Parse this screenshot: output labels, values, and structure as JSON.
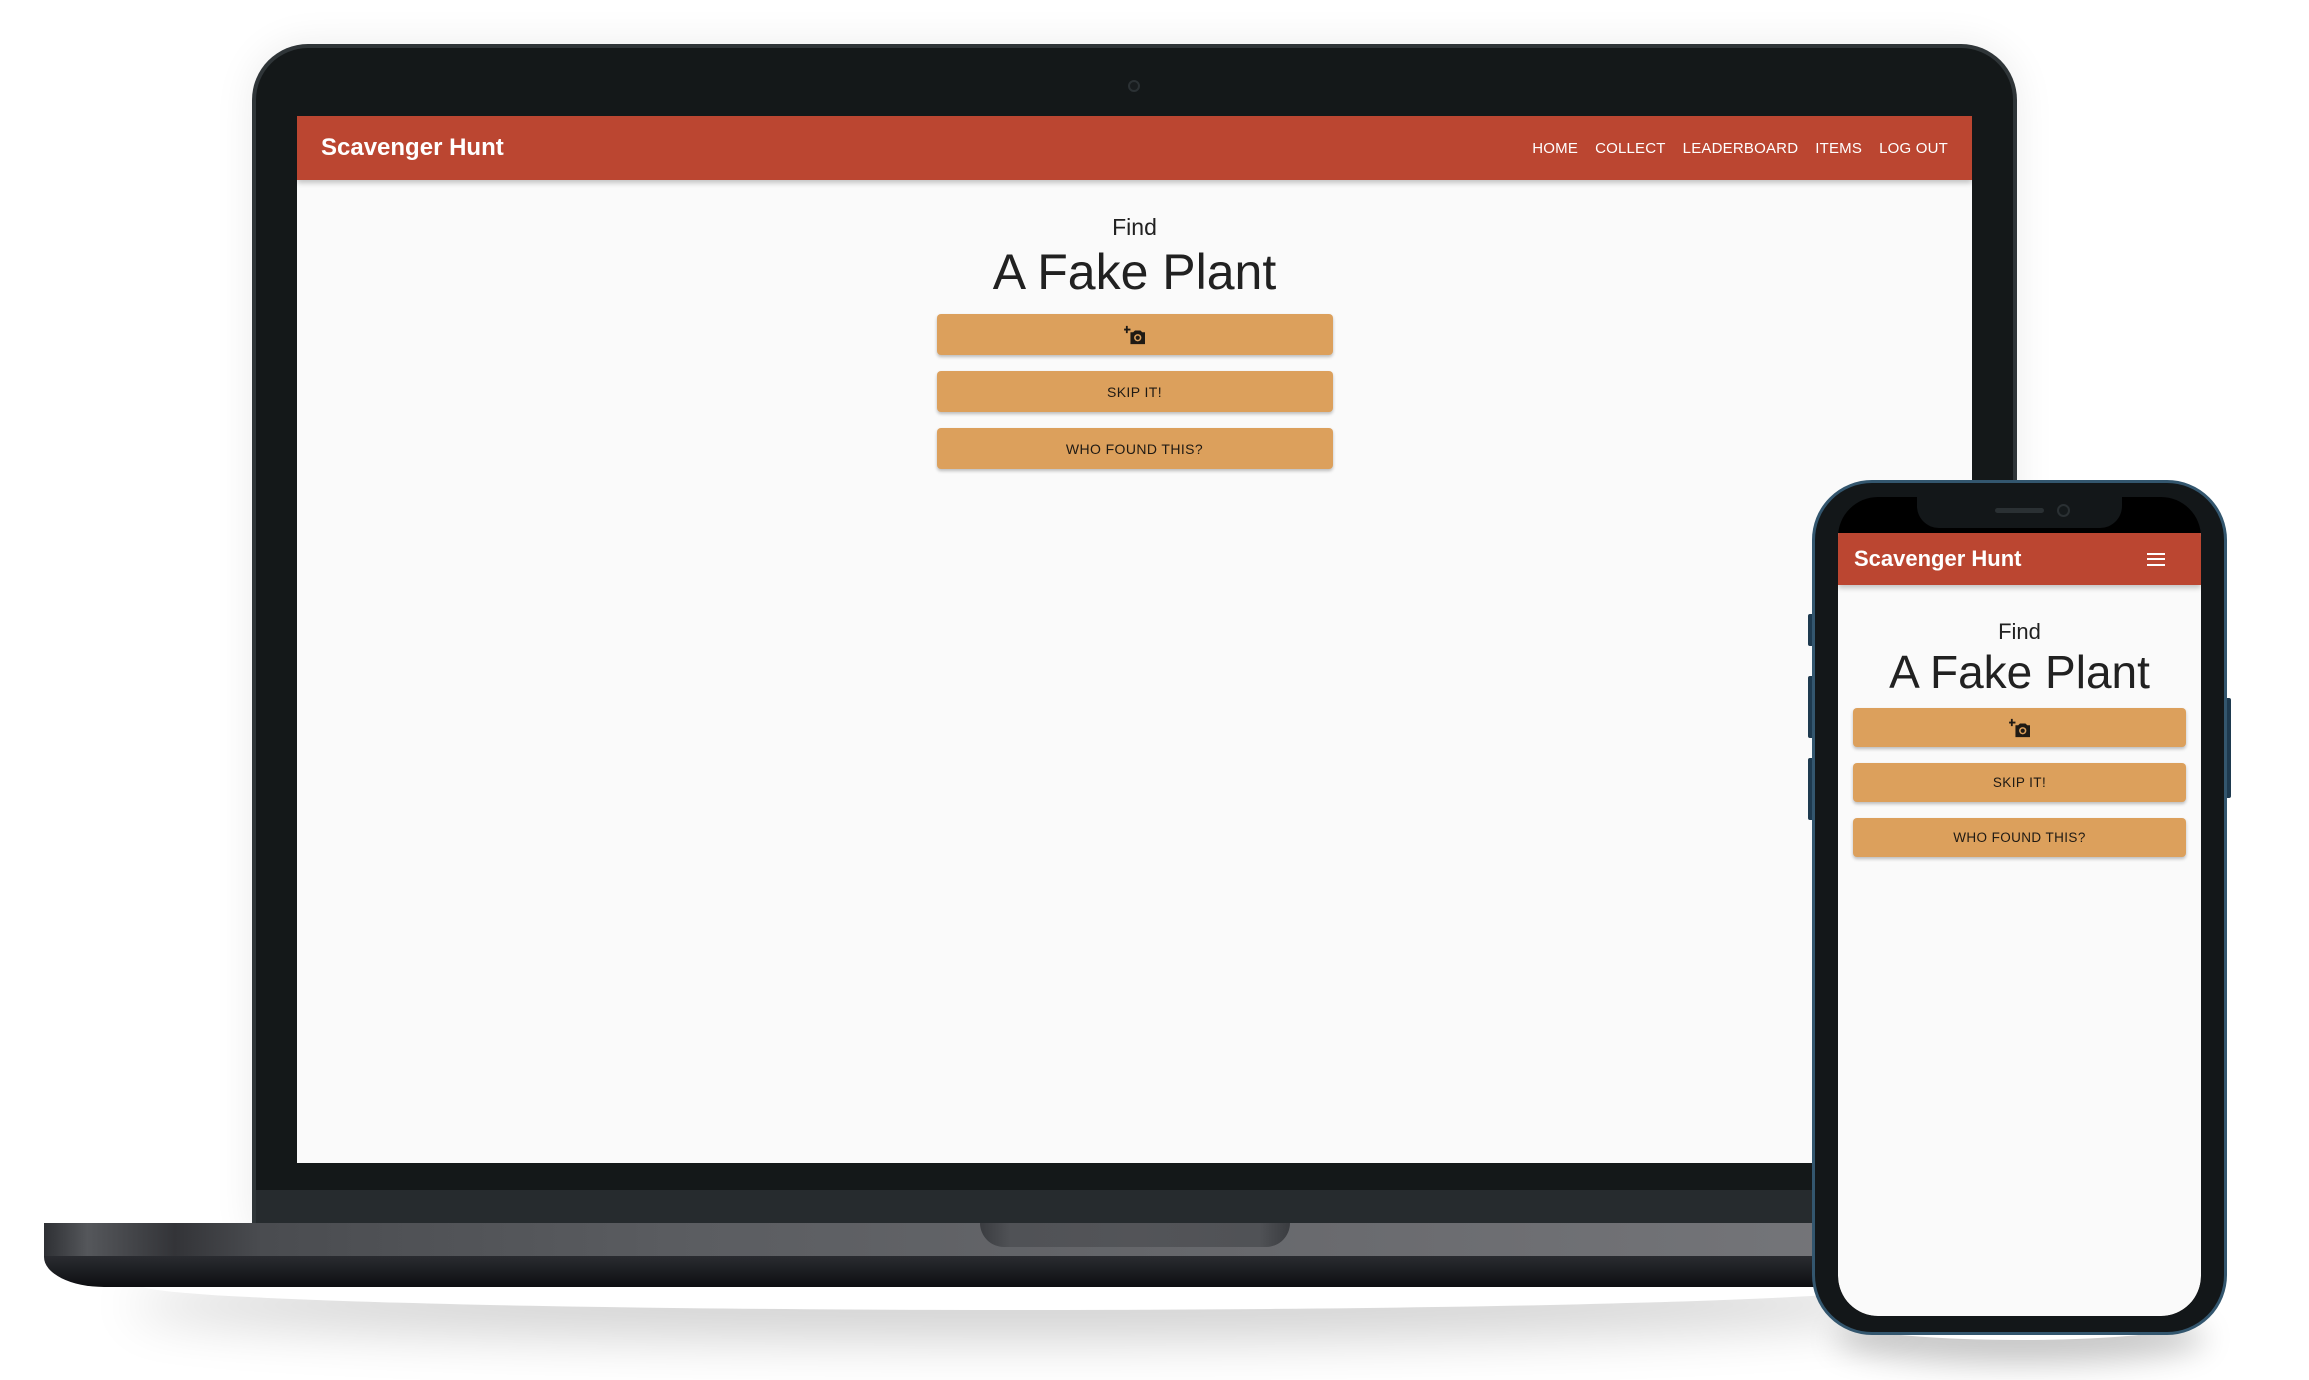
{
  "laptop": {
    "app": {
      "title": "Scavenger Hunt",
      "nav": [
        "Home",
        "Collect",
        "Leaderboard",
        "Items",
        "Log out"
      ]
    },
    "main": {
      "find_label": "Find",
      "target_name": "A Fake Plant",
      "buttons": {
        "photo_icon": "add-a-photo-icon",
        "skip_label": "Skip it!",
        "who_found_label": "Who found this?"
      }
    }
  },
  "phone": {
    "app": {
      "title": "Scavenger Hunt",
      "menu_icon": "hamburger-menu-icon"
    },
    "main": {
      "find_label": "Find",
      "target_name": "A Fake Plant",
      "buttons": {
        "photo_icon": "add-a-photo-icon",
        "skip_label": "Skip it!",
        "who_found_label": "Who found this?"
      }
    }
  },
  "colors": {
    "header": "#bb4631",
    "button": "#dca05c",
    "background": "#fafafa",
    "text": "#212121"
  }
}
